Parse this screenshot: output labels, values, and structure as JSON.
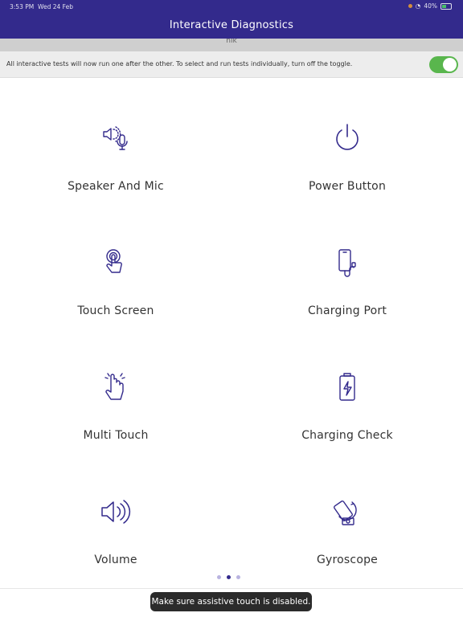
{
  "status_bar": {
    "time": "3:53 PM",
    "date": "Wed 24 Feb",
    "battery": "40%"
  },
  "header": {
    "title": "Interactive Diagnostics",
    "subtitle": "nik"
  },
  "notice": {
    "text": "All interactive tests will now run one after the other. To select and run tests individually, turn off the toggle.",
    "toggle_on": true
  },
  "tests": [
    {
      "label": "Speaker And Mic",
      "icon": "speaker-mic-icon"
    },
    {
      "label": "Power Button",
      "icon": "power-icon"
    },
    {
      "label": "Touch Screen",
      "icon": "touch-icon"
    },
    {
      "label": "Charging Port",
      "icon": "charging-port-icon"
    },
    {
      "label": "Multi Touch",
      "icon": "multi-touch-icon"
    },
    {
      "label": "Charging Check",
      "icon": "battery-charging-icon"
    },
    {
      "label": "Volume",
      "icon": "volume-icon"
    },
    {
      "label": "Gyroscope",
      "icon": "gyroscope-icon"
    }
  ],
  "pager": {
    "pages": 3,
    "current": 2
  },
  "toast": {
    "text": "Make sure assistive touch is disabled."
  },
  "colors": {
    "brand": "#332a8c",
    "toggle": "#59b64d"
  }
}
